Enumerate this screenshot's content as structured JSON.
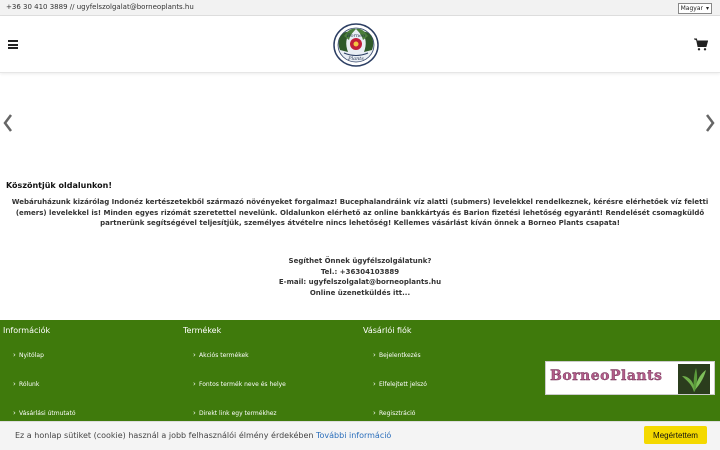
{
  "topbar": {
    "contact": "+36 30 410 3889 // ugyfelszolgalat@borneoplants.hu",
    "language": "Magyar"
  },
  "header": {
    "logo_text_top": "Borneo",
    "logo_text_bottom": "Plants"
  },
  "main": {
    "welcome_title": "Köszöntjük oldalunkon!",
    "intro_text": "Webáruházunk kizárólag Indonéz kertészetekből származó növényeket forgalmaz! Bucephalandráink víz alatti (submers) levelekkel rendelkeznek, kérésre elérhetőek víz feletti (emers) levelekkel is! Minden egyes rizómát szeretettel nevelünk. Oldalunkon elérhető az online bankkártyás és Barion fizetési lehetőség egyaránt! Rendelését csomagküldő partnerünk segítségével teljesítjük, személyes átvételre nincs lehetőség! Kellemes vásárlást kíván önnek a Borneo Plants csapata!",
    "support": {
      "question": "Segíthet Önnek ügyfélszolgálatunk?",
      "phone": "Tel.: +36304103889",
      "email": "E-mail: ugyfelszolgalat@borneoplants.hu",
      "online": "Online üzenetküldés itt..."
    }
  },
  "footer": {
    "columns": [
      {
        "title": "Információk",
        "items": [
          "Nyitólap",
          "Rólunk",
          "Vásárlási útmutató"
        ]
      },
      {
        "title": "Termékek",
        "items": [
          "Akciós termékek",
          "Fontos termék neve és helye",
          "Direkt link egy termékhez"
        ]
      },
      {
        "title": "Vásárlói fiók",
        "items": [
          "Bejelentkezés",
          "Elfelejtett jelszó",
          "Regisztráció"
        ]
      }
    ],
    "banner_text": "BorneoPlants"
  },
  "cookie": {
    "message": "Ez a honlap sütiket (cookie) használ a jobb felhasználói élmény érdekében",
    "more_info": "További információ",
    "accept": "Megértettem"
  },
  "colors": {
    "footer_bg": "#3f7a0c",
    "accept_button": "#f4d900",
    "link": "#2a6ebb"
  },
  "icons": [
    "hamburger-menu-icon",
    "cart-icon",
    "chevron-left-icon",
    "chevron-right-icon"
  ]
}
